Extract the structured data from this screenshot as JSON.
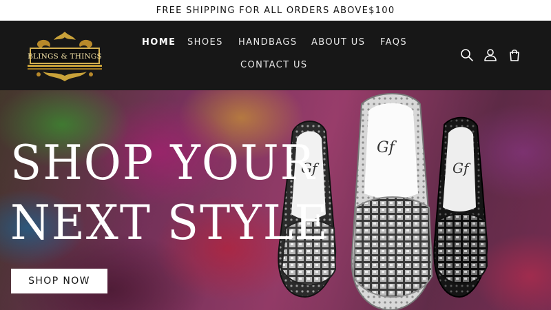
{
  "announcement": {
    "text": "FREE SHIPPING FOR ALL ORDERS ABOVE$100"
  },
  "header": {
    "logo_text": "BLINGS & THINGS",
    "nav": [
      {
        "label": "HOME",
        "active": true
      },
      {
        "label": "SHOES"
      },
      {
        "label": "HANDBAGS"
      },
      {
        "label": "ABOUT US"
      },
      {
        "label": "FAQS"
      },
      {
        "label": "CONTACT US"
      }
    ],
    "icons": [
      "search-icon",
      "account-icon",
      "cart-icon"
    ]
  },
  "hero": {
    "title_line1": "SHOP YOUR",
    "title_line2": "NEXT STYLE",
    "button_label": "SHOP NOW",
    "shoe_brand_text": "Gf"
  },
  "colors": {
    "header_bg": "#171717",
    "logo_gold": "#c9a23a",
    "hero_text": "#ffffff"
  }
}
